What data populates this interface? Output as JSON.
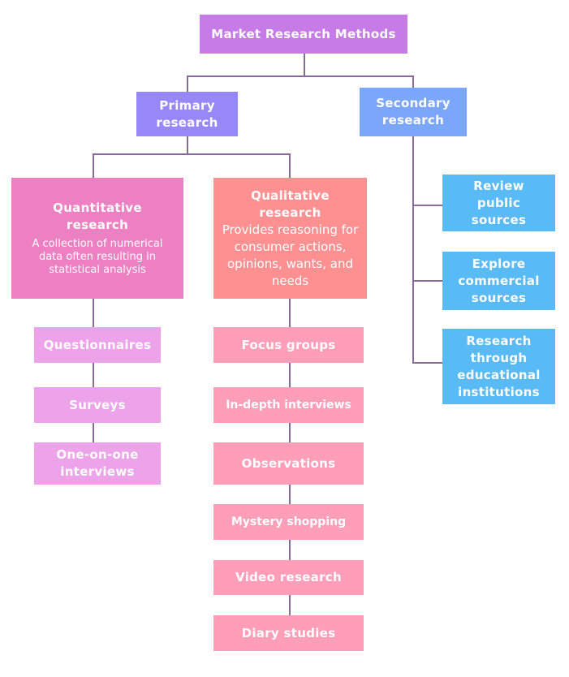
{
  "diagram": {
    "root": {
      "title": "Market Research Methods"
    },
    "primary": {
      "title": "Primary research"
    },
    "secondary": {
      "title": "Secondary research",
      "items": [
        {
          "label": "Review public sources"
        },
        {
          "label": "Explore commercial sources"
        },
        {
          "label": "Research through educational institutions"
        }
      ]
    },
    "quantitative": {
      "title": "Quantitative research",
      "description": "A collection of numerical data often resulting in statistical analysis",
      "items": [
        {
          "label": "Questionnaires"
        },
        {
          "label": "Surveys"
        },
        {
          "label": "One-on-one interviews"
        }
      ]
    },
    "qualitative": {
      "title": "Qualitative research",
      "description": "Provides reasoning for consumer actions, opinions, wants, and needs",
      "items": [
        {
          "label": "Focus groups"
        },
        {
          "label": "In-depth interviews"
        },
        {
          "label": "Observations"
        },
        {
          "label": "Mystery shopping"
        },
        {
          "label": "Video research"
        },
        {
          "label": "Diary studies"
        }
      ]
    },
    "colors": {
      "root": "#C77BE6",
      "primary": "#9887F8",
      "secondary": "#7BA7FB",
      "quantitative": "#EC80C2",
      "qualitative": "#FF9092",
      "secondary_items": "#59BBF5",
      "quantitative_items": "#EDA3E9",
      "qualitative_items": "#FF9EB8",
      "connector": "#8A6B98"
    }
  }
}
